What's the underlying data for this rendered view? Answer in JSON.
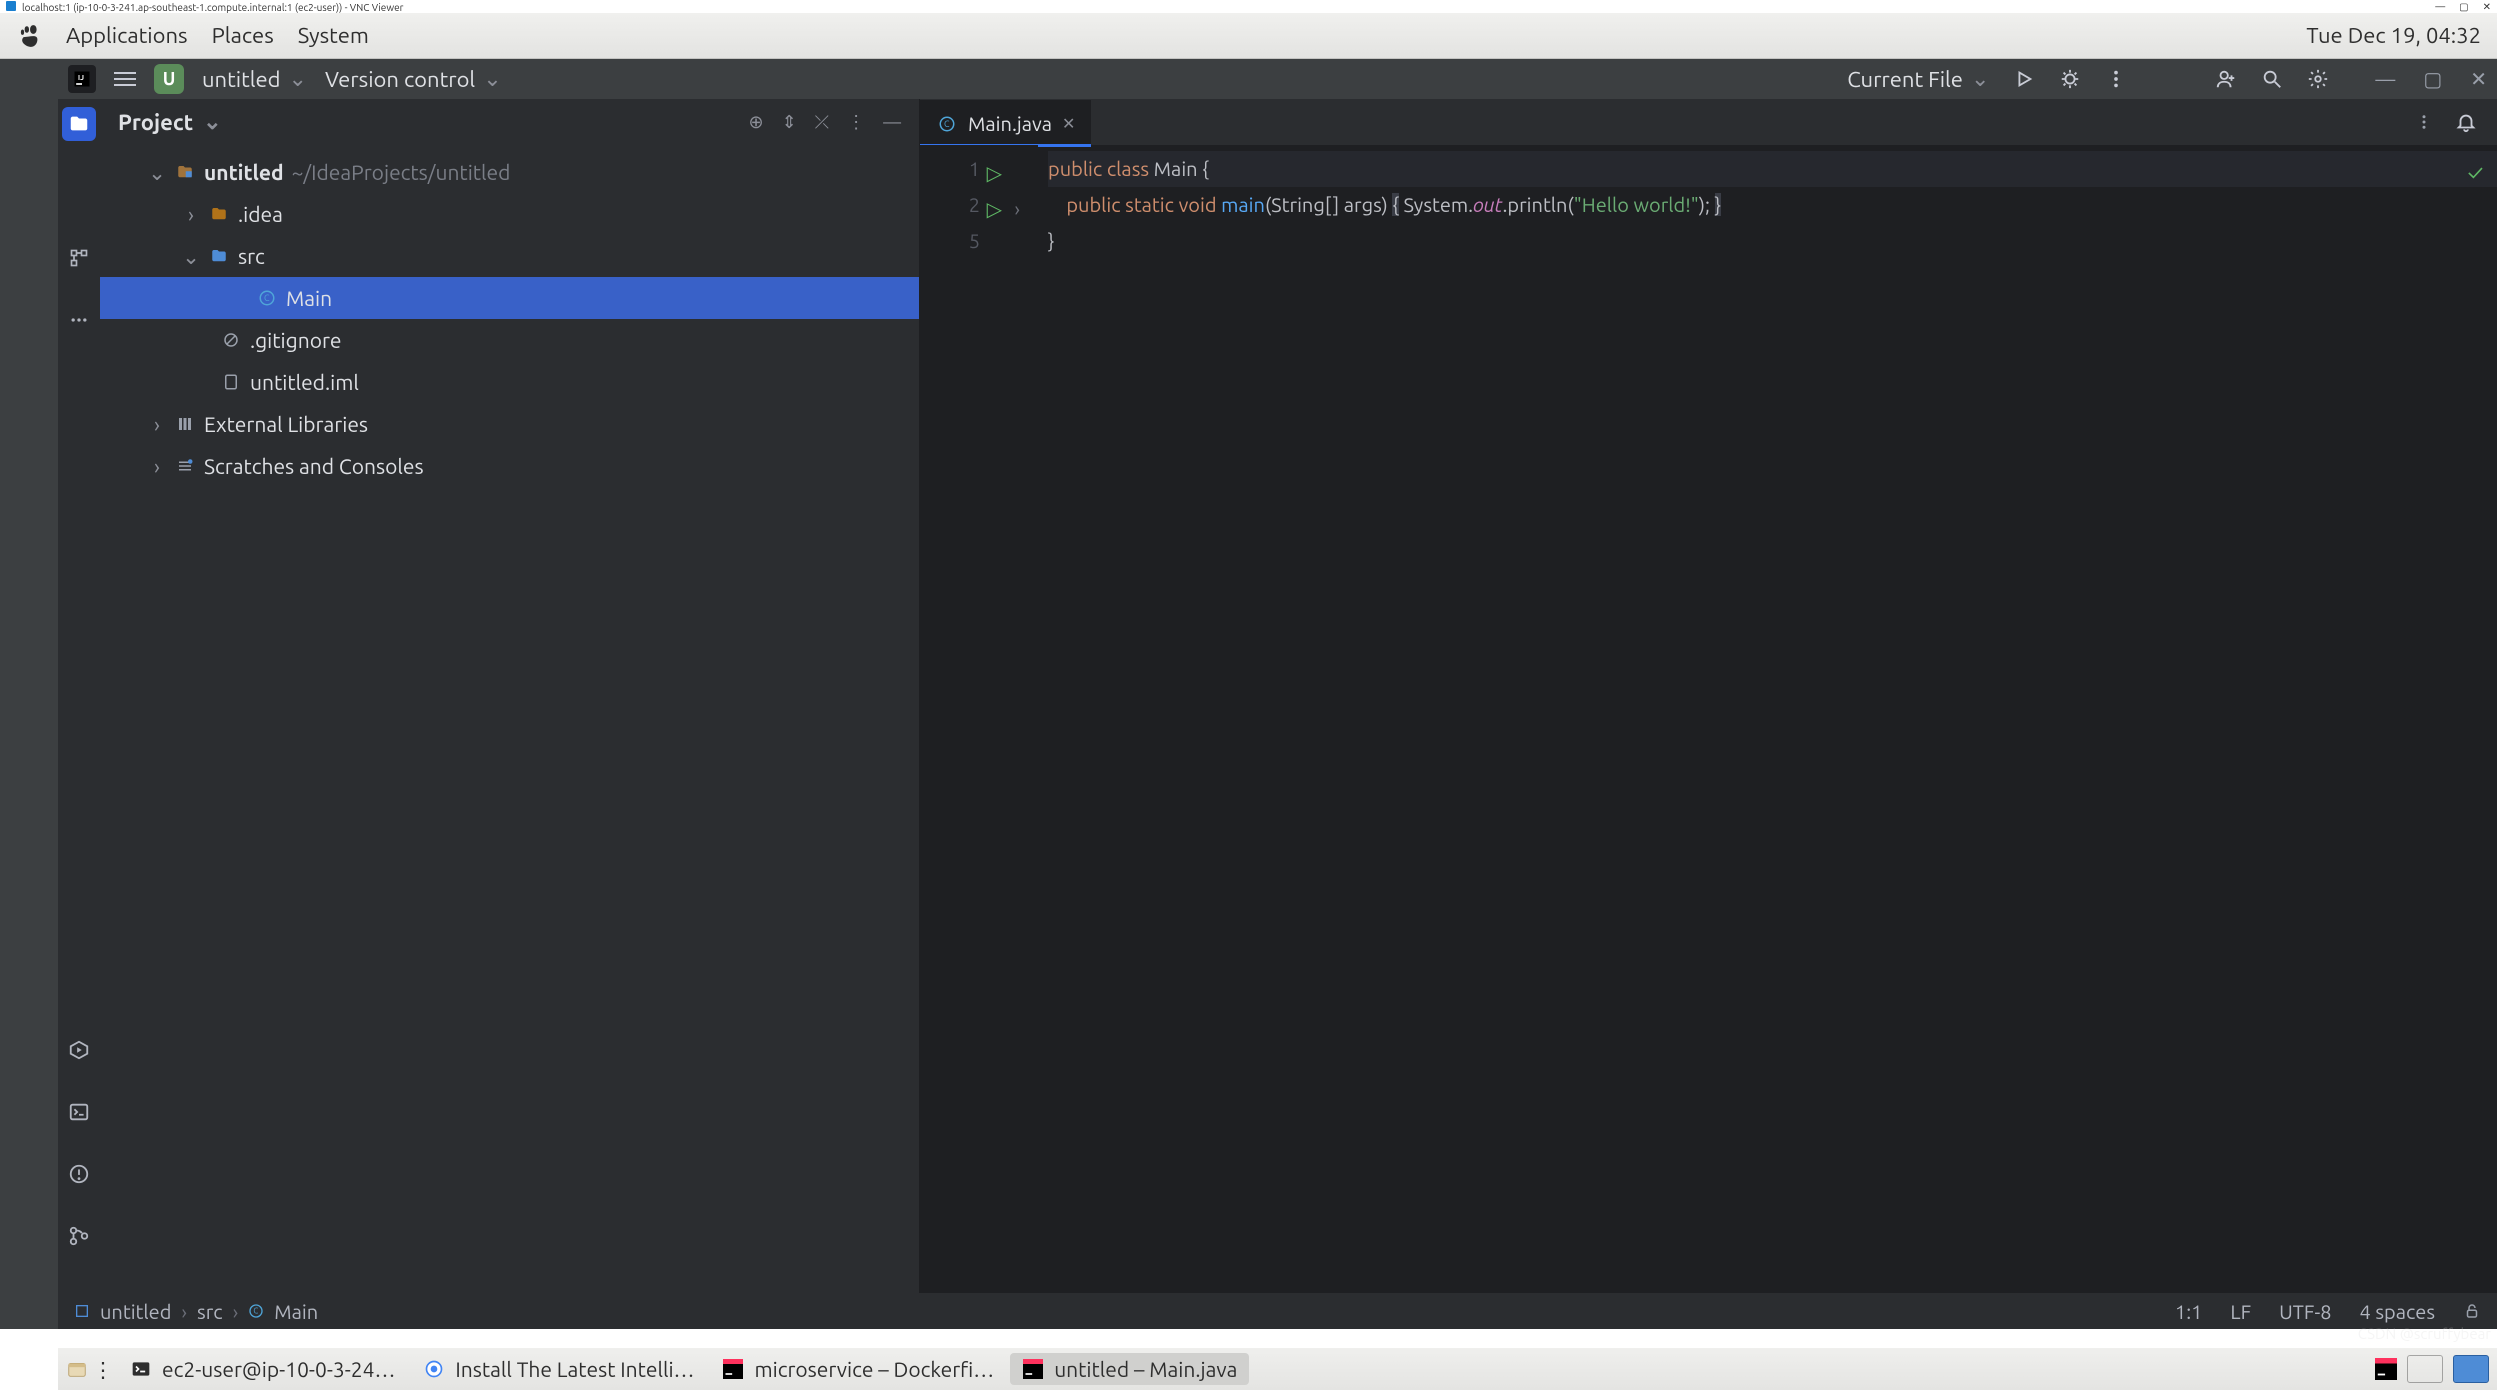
{
  "vnc": {
    "title": "localhost:1 (ip-10-0-3-241.ap-southeast-1.compute.internal:1 (ec2-user)) - VNC Viewer"
  },
  "gnome": {
    "menus": [
      "Applications",
      "Places",
      "System"
    ],
    "clock": "Tue Dec 19, 04:32"
  },
  "ide_title": {
    "project_badge": "U",
    "project_name": "untitled",
    "vcs": "Version control",
    "run_config": "Current File"
  },
  "project": {
    "title": "Project",
    "root_name": "untitled",
    "root_path": "~/IdeaProjects/untitled",
    "idea": ".idea",
    "src": "src",
    "main": "Main",
    "gitignore": ".gitignore",
    "iml": "untitled.iml",
    "ext": "External Libraries",
    "scratch": "Scratches and Consoles"
  },
  "editor": {
    "tab": "Main.java",
    "lines": {
      "l1": "1",
      "l2": "2",
      "l5": "5"
    },
    "code": {
      "kw_public": "public",
      "kw_class": "class",
      "cls_main": "Main",
      "brace_open": "{",
      "kw_static": "static",
      "kw_void": "void",
      "mth_main": "main",
      "sig_open": "(",
      "typ_string": "String[]",
      "arg": "args",
      "sig_close": ")",
      "b2o": "{",
      "sys": "System.",
      "out": "out",
      "println": ".println(",
      "str": "\"Hello world!\"",
      "println_close": ");",
      "b2c": "}",
      "b1c": "}"
    }
  },
  "status": {
    "crumb1": "untitled",
    "crumb2": "src",
    "crumb3": "Main",
    "pos": "1:1",
    "eol": "LF",
    "enc": "UTF-8",
    "indent": "4 spaces"
  },
  "taskbar": {
    "t1": "ec2-user@ip-10-0-3-24…",
    "t2": "Install The Latest Intelli…",
    "t3": "microservice – Dockerfi…",
    "t4": "untitled – Main.java"
  },
  "watermark": "CSDN @scruffybear"
}
